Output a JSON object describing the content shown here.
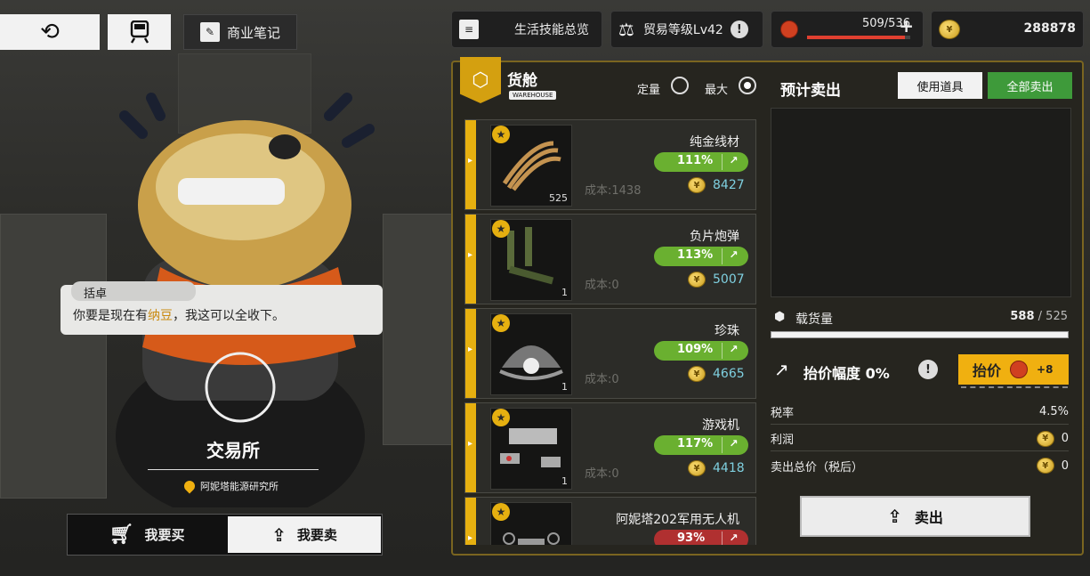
{
  "topbar": {
    "back_icon": "back-arrow-icon",
    "train_icon": "train-icon",
    "notes_label": "商业笔记"
  },
  "hud": {
    "skills_label": "生活技能总览",
    "trade_level": "贸易等级Lv42",
    "stamina": "509/536",
    "stamina_fraction": 0.95,
    "money": "288878"
  },
  "npc": {
    "speaker": "括卓",
    "dialog_prefix": "你要是现在有",
    "dialog_highlight": "纳豆",
    "dialog_suffix": "，我这可以全收下。"
  },
  "exchange": {
    "title": "交易所",
    "location": "阿妮塔能源研究所"
  },
  "mode_tabs": {
    "buy": "我要买",
    "sell": "我要卖",
    "active": "sell"
  },
  "warehouse": {
    "title": "货舱",
    "badge": "WAREHOUSE",
    "radio_fixed": "定量",
    "radio_max": "最大",
    "selected": "max",
    "items": [
      {
        "name": "纯金线材",
        "pct": "111%",
        "status": "up",
        "cost": "成本:1438",
        "price": "8427",
        "qty": "525",
        "art": "wire-coil-icon"
      },
      {
        "name": "负片炮弹",
        "pct": "113%",
        "status": "up",
        "cost": "成本:0",
        "price": "5007",
        "qty": "1",
        "art": "shell-ammo-icon"
      },
      {
        "name": "珍珠",
        "pct": "109%",
        "status": "up",
        "cost": "成本:0",
        "price": "4665",
        "qty": "1",
        "art": "pearl-icon"
      },
      {
        "name": "游戏机",
        "pct": "117%",
        "status": "up",
        "cost": "成本:0",
        "price": "4418",
        "qty": "1",
        "art": "game-console-icon"
      },
      {
        "name": "阿妮塔202军用无人机",
        "pct": "93%",
        "status": "down",
        "cost": "",
        "price": "",
        "qty": "",
        "art": "drone-icon"
      }
    ]
  },
  "estimate": {
    "title": "预计卖出",
    "use_item": "使用道具",
    "sell_all": "全部卖出"
  },
  "cargo": {
    "label": "载货量",
    "used": "588",
    "sep": " / ",
    "capacity": "525",
    "fill_fraction": 1.0
  },
  "hike": {
    "label": "抬价幅度 0%",
    "button": "抬价",
    "count": "+8"
  },
  "summary": {
    "tax_label": "税率",
    "tax_value": "4.5%",
    "profit_label": "利润",
    "profit_value": "0",
    "total_label": "卖出总价（税后）",
    "total_value": "0"
  },
  "sell_button": "卖出",
  "colors": {
    "accent_gold": "#e6b010",
    "positive_green": "#6ab030",
    "negative_red": "#b03030",
    "sell_all_green": "#3e9a3a"
  }
}
